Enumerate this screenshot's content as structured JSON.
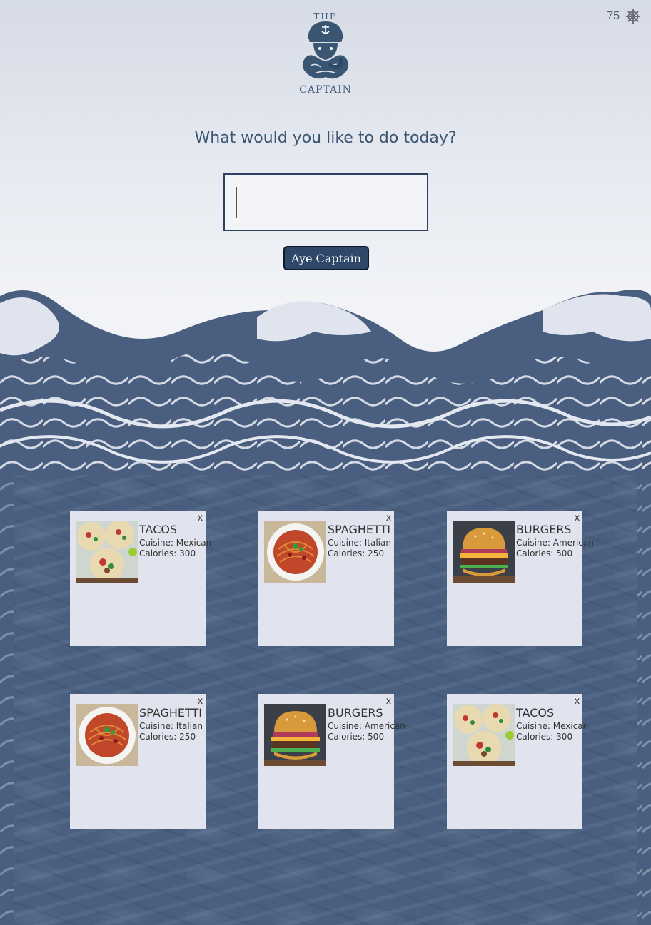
{
  "header": {
    "counter_value": "75",
    "logo_top_text": "THE",
    "logo_bottom_text": "CAPTAIN"
  },
  "main": {
    "prompt": "What would you like to do today?",
    "input_value": "",
    "submit_label": "Aye Captain"
  },
  "cards": [
    {
      "name": "TACOS",
      "cuisine": "Cuisine: Mexican",
      "calories": "Calories: 300",
      "image": "tacos",
      "close": "x"
    },
    {
      "name": "SPAGHETTI",
      "cuisine": "Cuisine: Italian",
      "calories": "Calories: 250",
      "image": "spaghetti",
      "close": "x"
    },
    {
      "name": "BURGERS",
      "cuisine": "Cuisine: American",
      "calories": "Calories: 500",
      "image": "burgers",
      "close": "x"
    },
    {
      "name": "SPAGHETTI",
      "cuisine": "Cuisine: Italian",
      "calories": "Calories: 250",
      "image": "spaghetti",
      "close": "x"
    },
    {
      "name": "BURGERS",
      "cuisine": "Cuisine: American",
      "calories": "Calories: 500",
      "image": "burgers",
      "close": "x"
    },
    {
      "name": "TACOS",
      "cuisine": "Cuisine: Mexican",
      "calories": "Calories: 300",
      "image": "tacos",
      "close": "x"
    }
  ],
  "colors": {
    "accent": "#2d4868",
    "wave": "#4a5f80",
    "card": "#e1e4ee"
  }
}
